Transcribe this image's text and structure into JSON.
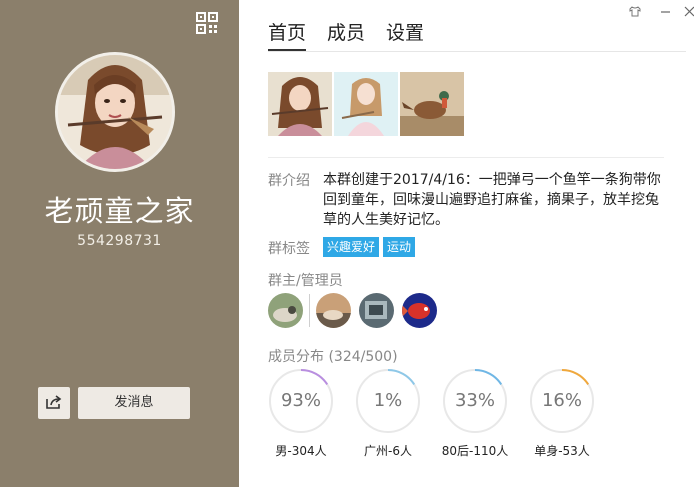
{
  "group": {
    "name": "老顽童之家",
    "id": "554298731"
  },
  "actions": {
    "send_message": "发消息"
  },
  "tabs": [
    {
      "label": "首页",
      "active": true
    },
    {
      "label": "成员",
      "active": false
    },
    {
      "label": "设置",
      "active": false
    }
  ],
  "info": {
    "intro_label": "群介绍",
    "intro_text": "本群创建于2017/4/16：一把弹弓一个鱼竿一条狗带你回到童年，回味漫山遍野追打麻雀，摘果子，放羊挖兔草的人生美好记忆。",
    "tags_label": "群标签",
    "tags": [
      "兴趣爱好",
      "运动"
    ],
    "admins_label": "群主/管理员",
    "members_label": "成员分布",
    "members_count": "(324/500)"
  },
  "stats": [
    {
      "percent": "93%",
      "value": 93,
      "label": "男-304人",
      "color": "#b98ee0"
    },
    {
      "percent": "1%",
      "value": 1,
      "label": "广州-6人",
      "color": "#8ec8e8"
    },
    {
      "percent": "33%",
      "value": 33,
      "label": "80后-110人",
      "color": "#6fb7e6"
    },
    {
      "percent": "16%",
      "value": 16,
      "label": "单身-53人",
      "color": "#f0a83c"
    }
  ],
  "colors": {
    "left_panel": "#8b7f6b",
    "tag_blue": "#2fa8e6"
  }
}
